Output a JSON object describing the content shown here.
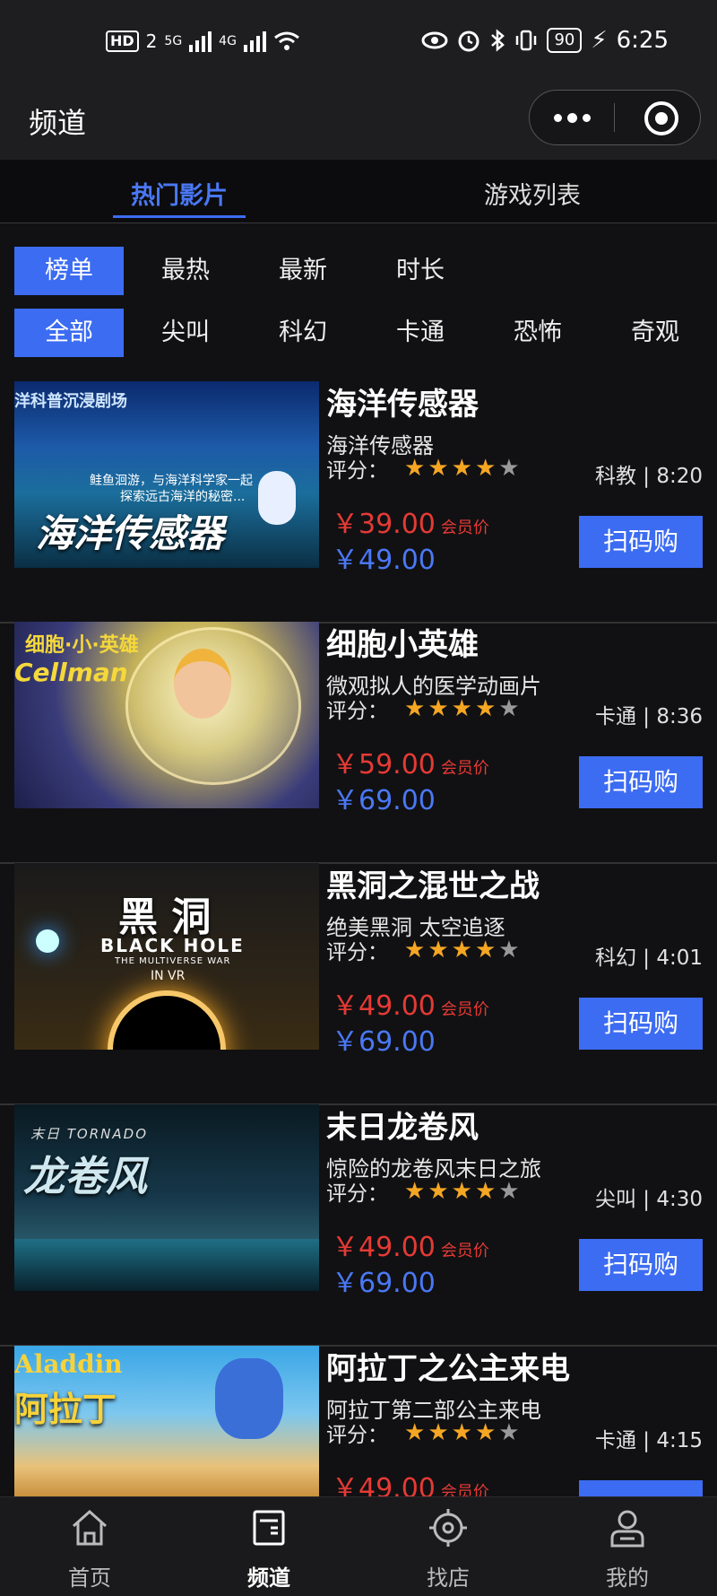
{
  "status": {
    "hd": "HD",
    "sim": "2",
    "net1": "5G",
    "net2": "4G",
    "battery": "90",
    "time": "6:25"
  },
  "navbar": {
    "title": "频道"
  },
  "tabs": [
    "热门影片",
    "游戏列表"
  ],
  "sort_chips": [
    "榜单",
    "最热",
    "最新",
    "时长"
  ],
  "category_chips": [
    "全部",
    "尖叫",
    "科幻",
    "卡通",
    "恐怖",
    "奇观"
  ],
  "price_prefix": "￥",
  "member_label": "会员价",
  "rating_label": "评分：",
  "buy_label": "扫码购",
  "items": [
    {
      "name": "海洋传感器",
      "desc": "海洋传感器",
      "meta": "科教 | 8:20",
      "member_price": "39.00",
      "price": "49.00",
      "rating": 4,
      "thumb_title": "海洋传感器",
      "thumb_top": "洋科普沉浸剧场",
      "thumb_line1": "鲑鱼洄游，与海洋科学家一起",
      "thumb_line2": "探索远古海洋的秘密..."
    },
    {
      "name": "细胞小英雄",
      "desc": "微观拟人的医学动画片",
      "meta": "卡通 | 8:36",
      "member_price": "59.00",
      "price": "69.00",
      "rating": 4,
      "thumb_title": "细胞·小·英雄",
      "thumb_top": "Cellman"
    },
    {
      "name": "黑洞之混世之战",
      "desc": "绝美黑洞 太空追逐",
      "meta": "科幻 | 4:01",
      "member_price": "49.00",
      "price": "69.00",
      "rating": 4,
      "thumb_title": "黑 洞",
      "thumb_top": "BLACK HOLE",
      "thumb_line1": "THE MULTIVERSE WAR",
      "thumb_line2": "IN VR"
    },
    {
      "name": "末日龙卷风",
      "desc": "惊险的龙卷风末日之旅",
      "meta": "尖叫 | 4:30",
      "member_price": "49.00",
      "price": "69.00",
      "rating": 4,
      "thumb_title": "龙卷风",
      "thumb_top": "末日 TORNADO"
    },
    {
      "name": "阿拉丁之公主来电",
      "desc": "阿拉丁第二部公主来电",
      "meta": "卡通 | 4:15",
      "member_price": "49.00",
      "price": "",
      "rating": 4,
      "thumb_title": "阿拉丁",
      "thumb_top": "Aladdin"
    }
  ],
  "bottom_nav": [
    "首页",
    "频道",
    "找店",
    "我的"
  ],
  "colors": {
    "accent": "#3c6cf2",
    "member_red": "#e63a35",
    "star": "#f5a623",
    "bg": "#111113"
  }
}
